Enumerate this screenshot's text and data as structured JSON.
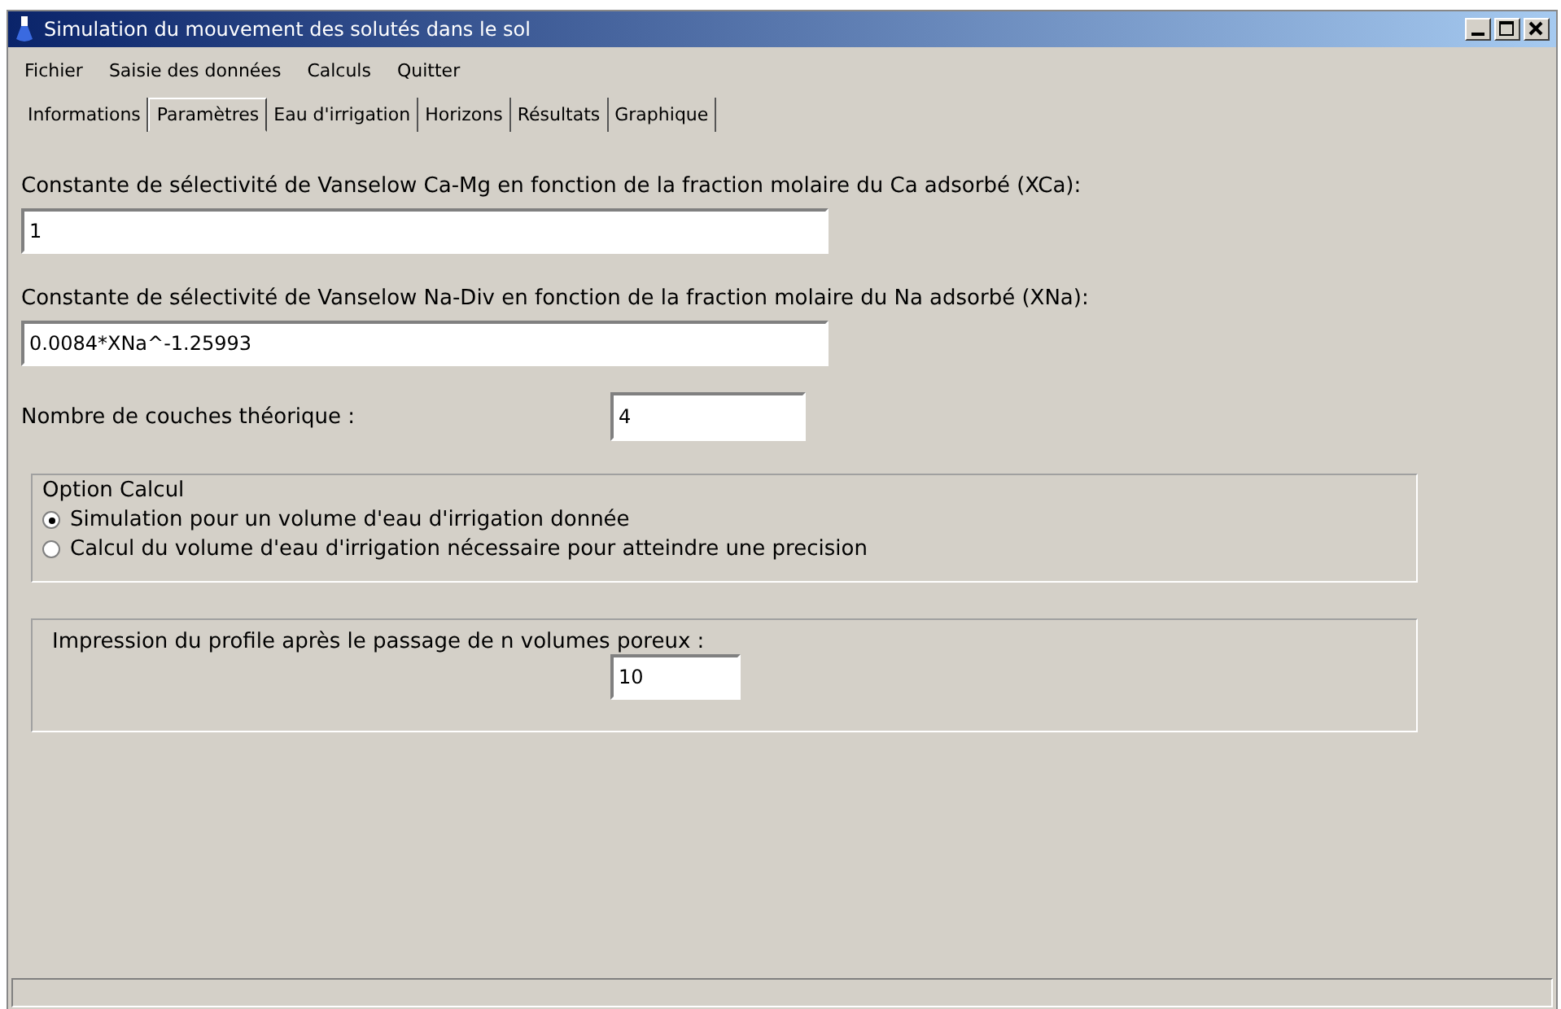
{
  "window": {
    "title": "Simulation du mouvement des solutés dans le sol"
  },
  "menu": [
    "Fichier",
    "Saisie des données",
    "Calculs",
    "Quitter"
  ],
  "tabs": [
    {
      "label": "Informations",
      "selected": false
    },
    {
      "label": "Paramètres",
      "selected": true
    },
    {
      "label": "Eau d'irrigation",
      "selected": false
    },
    {
      "label": "Horizons",
      "selected": false
    },
    {
      "label": "Résultats",
      "selected": false
    },
    {
      "label": "Graphique",
      "selected": false
    }
  ],
  "ca_mg": {
    "label": "Constante de sélectivité de Vanselow Ca-Mg en fonction de la fraction molaire du Ca adsorbé (XCa):",
    "value": "1"
  },
  "na_div": {
    "label": "Constante de sélectivité de Vanselow Na-Div en fonction de la fraction molaire du Na adsorbé (XNa):",
    "value": "0.0084*XNa^-1.25993"
  },
  "layers": {
    "label": "Nombre de couches théorique :",
    "value": "4"
  },
  "option_calcul": {
    "title": "Option Calcul",
    "options": [
      {
        "label": "Simulation pour un volume d'eau d'irrigation donnée",
        "selected": true
      },
      {
        "label": "Calcul du volume d'eau d'irrigation nécessaire pour atteindre une precision",
        "selected": false
      }
    ]
  },
  "printout": {
    "label": "Impression du profile après le passage de n volumes poreux :",
    "value": "10"
  }
}
